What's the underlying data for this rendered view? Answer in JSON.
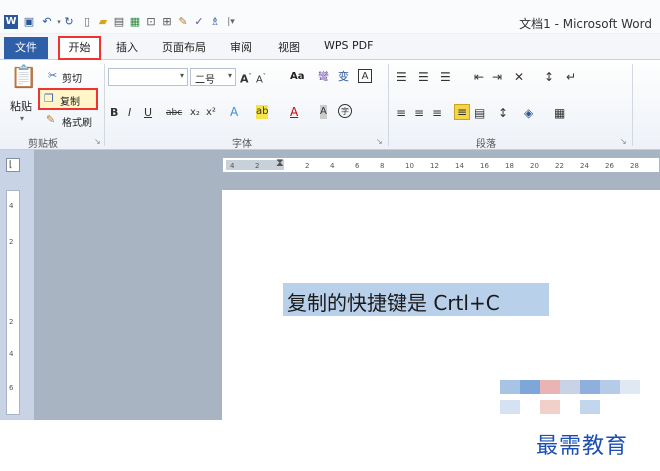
{
  "titlebar": {
    "title": "文档1 - Microsoft Word",
    "quick_access_icons": [
      "word-logo-icon",
      "save-icon",
      "undo-icon",
      "redo-icon",
      "new-doc-icon",
      "open-icon",
      "print-icon",
      "print-preview-icon",
      "spelling-icon",
      "format-painter-icon",
      "drawing-icon",
      "customize-icon"
    ]
  },
  "tabs": {
    "file": "文件",
    "home": "开始",
    "insert": "插入",
    "layout": "页面布局",
    "review": "审阅",
    "view": "视图",
    "wps": "WPS PDF"
  },
  "clipboard": {
    "paste": "粘贴",
    "cut": "剪切",
    "copy": "复制",
    "format_painter": "格式刷",
    "group_label": "剪贴板"
  },
  "font": {
    "font_name": "",
    "font_size": "二号",
    "change_case": "Aa",
    "group_label": "字体"
  },
  "paragraph": {
    "group_label": "段落"
  },
  "ruler": {
    "ticks": [
      "4",
      "2",
      "",
      "2",
      "4",
      "6",
      "8",
      "10",
      "12",
      "14",
      "16",
      "18",
      "20",
      "22",
      "24",
      "26",
      "28"
    ],
    "vticks": [
      "4",
      "2",
      "",
      "2",
      "4",
      "6"
    ]
  },
  "document": {
    "text": "复制的快捷键是 Crtl+C"
  },
  "watermark": {
    "text": "最需教育"
  }
}
